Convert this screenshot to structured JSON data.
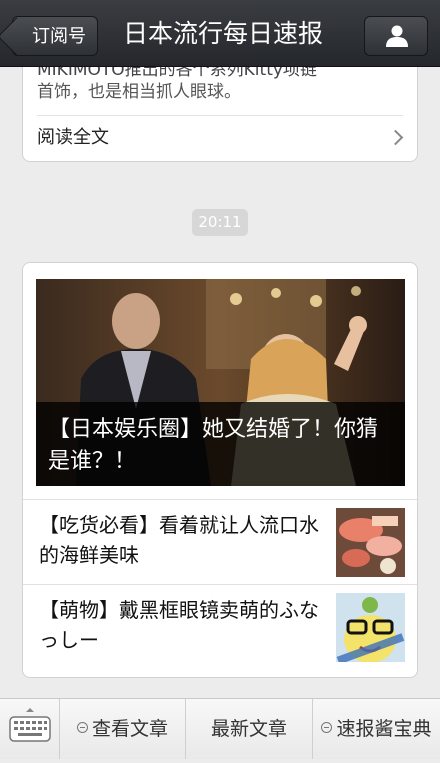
{
  "header": {
    "back_label": "订阅号",
    "title": "日本流行每日速报"
  },
  "previous_article": {
    "partial_line_1": "MIKIMOTO推出的各个系列Kitty项链",
    "partial_line_2": "首饰，也是相当抓人眼球。",
    "read_all_label": "阅读全文"
  },
  "timestamp": "20:11",
  "article_group": {
    "main": {
      "title": "【日本娱乐圈】她又结婚了！你猜是谁？！"
    },
    "items": [
      {
        "title": "【吃货必看】看着就让人流口水的海鲜美味",
        "thumb": "seafood-thumbnail"
      },
      {
        "title": "【萌物】戴黑框眼镜卖萌的ふなっしー",
        "thumb": "funassyi-thumbnail"
      }
    ]
  },
  "bottom_menu": {
    "items": [
      {
        "label": "查看文章",
        "has_submenu": true
      },
      {
        "label": "最新文章",
        "has_submenu": false
      },
      {
        "label": "速报酱宝典",
        "has_submenu": true
      }
    ]
  },
  "colors": {
    "topbar": "#2e3135",
    "page_bg": "#ececec",
    "card_bg": "#ffffff"
  }
}
